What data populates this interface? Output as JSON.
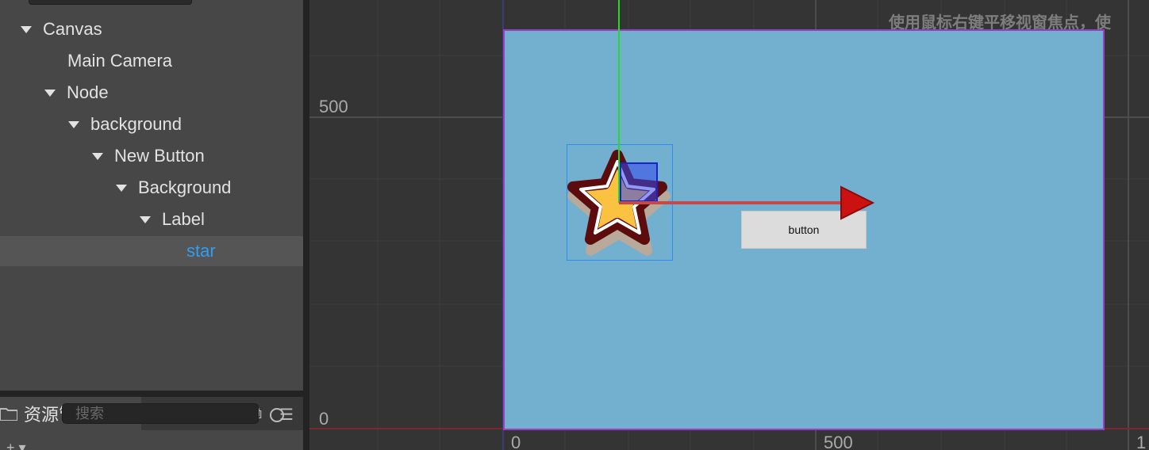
{
  "hierarchy": {
    "items": [
      {
        "label": "Canvas",
        "expanded": true,
        "depth": 0
      },
      {
        "label": "Main Camera",
        "expanded": false,
        "depth": 1
      },
      {
        "label": "Node",
        "expanded": true,
        "depth": 1
      },
      {
        "label": "background",
        "expanded": true,
        "depth": 2
      },
      {
        "label": "New Button",
        "expanded": true,
        "depth": 3
      },
      {
        "label": "Background",
        "expanded": true,
        "depth": 4
      },
      {
        "label": "Label",
        "expanded": true,
        "depth": 5
      },
      {
        "label": "star",
        "expanded": false,
        "depth": 6,
        "selected": true
      }
    ]
  },
  "assets": {
    "tab_title": "资源管理器",
    "search_placeholder": "搜索",
    "add_label": "+ ▾"
  },
  "scene": {
    "hint": "使用鼠标右键平移视窗焦点，使",
    "axis_y": [
      "500",
      "0"
    ],
    "axis_x": [
      "0",
      "500",
      "1"
    ],
    "button_label": "button",
    "canvas_color": "#73b0cf",
    "selection_color": "#2f8cf0",
    "x_gizmo_color": "#cc1111",
    "y_gizmo_color": "#22dd22"
  },
  "icons": [
    "folder-icon",
    "restore-icon",
    "menu-icon",
    "search-icon",
    "star-icon"
  ]
}
